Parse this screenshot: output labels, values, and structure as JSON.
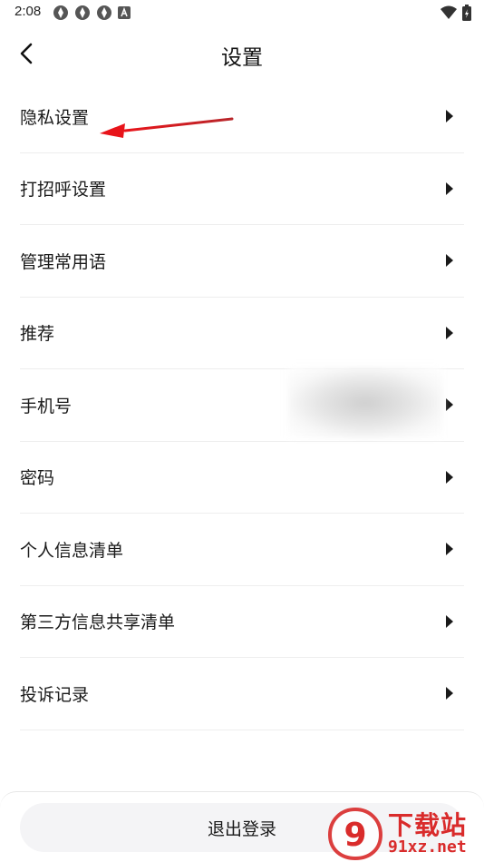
{
  "status_bar": {
    "time": "2:08",
    "left_icons": [
      "app-notification-icon",
      "app-notification-icon",
      "app-notification-icon",
      "a-icon"
    ],
    "right_icons": [
      "wifi-icon",
      "battery-charging-icon"
    ]
  },
  "header": {
    "title": "设置",
    "back_icon": "chevron-left-icon"
  },
  "settings": {
    "items": [
      {
        "label": "隐私设置"
      },
      {
        "label": "打招呼设置"
      },
      {
        "label": "管理常用语"
      },
      {
        "label": "推荐"
      },
      {
        "label": "手机号"
      },
      {
        "label": "密码"
      },
      {
        "label": "个人信息清单"
      },
      {
        "label": "第三方信息共享清单"
      },
      {
        "label": "投诉记录"
      }
    ]
  },
  "footer": {
    "logout_label": "退出登录"
  },
  "watermark": {
    "line1": "下载站",
    "line2": "91xz.net",
    "badge": "9"
  },
  "colors": {
    "accent_red": "#d92b2b",
    "divider": "#eeeeee",
    "button_bg": "#f4f4f6"
  }
}
